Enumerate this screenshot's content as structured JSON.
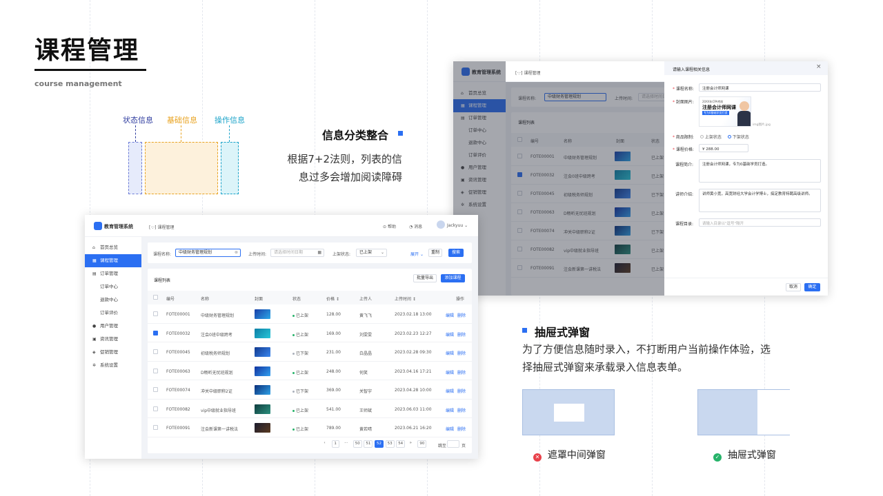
{
  "page": {
    "title": "课程管理",
    "subtitle": "course management"
  },
  "diagram": {
    "status_label": "状态信息",
    "basic_label": "基础信息",
    "action_label": "操作信息",
    "colors": {
      "status": "#2c3a9e",
      "basic": "#e8a21f",
      "action": "#1aa3c9"
    }
  },
  "section_info": {
    "heading": "信息分类整合",
    "line1": "根据7+2法则，列表的信",
    "line2": "息过多会增加阅读障碍"
  },
  "section_drawer": {
    "heading": "抽屉式弹窗",
    "line1": "为了方便信息随时录入，不打断用户当前操作体验，选",
    "line2": "择抽屉式弹窗来承载录入信息表单。",
    "bad_caption": "遮罩中间弹窗",
    "good_caption": "抽屉式弹窗",
    "bad_icon": "close-circle-icon",
    "good_icon": "check-circle-icon"
  },
  "app": {
    "name": "教育管理系统",
    "breadcrumb": "课程管理",
    "breadcrumb_icon": "[·:·]",
    "help": "帮助",
    "messages": "消息",
    "user": "Jackyuu",
    "nav": [
      {
        "label": "首页总览",
        "icon": "home-icon",
        "level": 1,
        "active": false
      },
      {
        "label": "课程管理",
        "icon": "grid-icon",
        "level": 1,
        "active": true
      },
      {
        "label": "订单管理",
        "icon": "order-icon",
        "level": 1,
        "active": false
      },
      {
        "label": "订单中心",
        "level": 2,
        "active": false
      },
      {
        "label": "退款中心",
        "level": 2,
        "active": false
      },
      {
        "label": "订单评价",
        "level": 2,
        "active": false
      },
      {
        "label": "用户管理",
        "icon": "user-icon",
        "level": 1,
        "active": false
      },
      {
        "label": "资讯管理",
        "icon": "news-icon",
        "level": 1,
        "active": false
      },
      {
        "label": "促销管理",
        "icon": "promo-icon",
        "level": 1,
        "active": false
      },
      {
        "label": "系统设置",
        "icon": "gear-icon",
        "level": 1,
        "active": false
      }
    ],
    "filters": {
      "course_name_label": "课程名称:",
      "course_name_value": "中级财务管理规划",
      "time_label": "上传时间:",
      "time_placeholder": "请选择时间日期",
      "status_label": "上架状态:",
      "status_value": "已上架",
      "expand": "展开",
      "reset": "重制",
      "search": "搜索"
    },
    "list": {
      "title": "课程列表",
      "export": "批量导出",
      "add": "添加课程",
      "columns": [
        "编号",
        "名称",
        "封面",
        "状态",
        "价格",
        "上传人",
        "上传时间",
        "操作"
      ],
      "edit": "编辑",
      "delete": "删除",
      "rows": [
        {
          "id": "FOTE00001",
          "name": "中级财务管理规划",
          "status": "已上架",
          "price": "128.00",
          "uploader": "黄飞飞",
          "time": "2023.02.18 13:00",
          "checked": false
        },
        {
          "id": "FOTE00032",
          "name": "注会0班中级跨考",
          "status": "已上架",
          "price": "169.00",
          "uploader": "刘雯雯",
          "time": "2023.02.23 12:27",
          "checked": true
        },
        {
          "id": "FOTE00045",
          "name": "初级税务师规划",
          "status": "已下架",
          "price": "231.00",
          "uploader": "白晶晶",
          "time": "2023.02.28 09:30",
          "checked": false
        },
        {
          "id": "FOTE00063",
          "name": "D畅听无忧班规划",
          "status": "已上架",
          "price": "248.00",
          "uploader": "何笑",
          "time": "2023.04.16 17:21",
          "checked": false
        },
        {
          "id": "FOTE00074",
          "name": "冲关中级职称2证",
          "status": "已下架",
          "price": "369.00",
          "uploader": "关智宇",
          "time": "2023.04.28 10:00",
          "checked": false
        },
        {
          "id": "FOTE00082",
          "name": "vip中级就业指导班",
          "status": "已上架",
          "price": "541.00",
          "uploader": "王师斌",
          "time": "2023.06.03 11:00",
          "checked": false
        },
        {
          "id": "FOTE00091",
          "name": "注会新课第一讲税法",
          "status": "已上架",
          "price": "789.00",
          "uploader": "黄若晴",
          "time": "2023.06.21 16:20",
          "checked": false
        }
      ],
      "pagination": [
        "‹",
        "1",
        "···",
        "50",
        "51",
        "52",
        "53",
        "54",
        "»",
        "90"
      ],
      "current_page": "52",
      "jump_label": "跳至",
      "page_unit": "页"
    }
  },
  "drawer": {
    "title": "请输入课程相关信息",
    "close": "×",
    "name_label": "课程名称:",
    "name_value": "注册会计师网课",
    "cover_label": "封面图片:",
    "cover_title": "注册会计师网课",
    "cover_sub": "专为0基础学员打造",
    "cover_tag": "20XX年CPA考前",
    "cover_caption": "img图片.jpg",
    "limit_label": "商品限制:",
    "limit_options": [
      "上架状态",
      "下架状态"
    ],
    "limit_selected": "下架状态",
    "price_label": "课程价格:",
    "price_value": "¥ 288.00",
    "intro_label": "课程简介:",
    "intro_value": "注册会计师网课，专为0基础学员打造。",
    "teacher_label": "讲师介绍:",
    "teacher_value": "讲师黄小宽，高宽财经大学会计学博士，搞定教育特聘高级讲师。",
    "catalog_label": "课程目录:",
    "catalog_placeholder": "请输入目录以\"逗号\"隔开",
    "cancel": "取消",
    "confirm": "确定"
  }
}
